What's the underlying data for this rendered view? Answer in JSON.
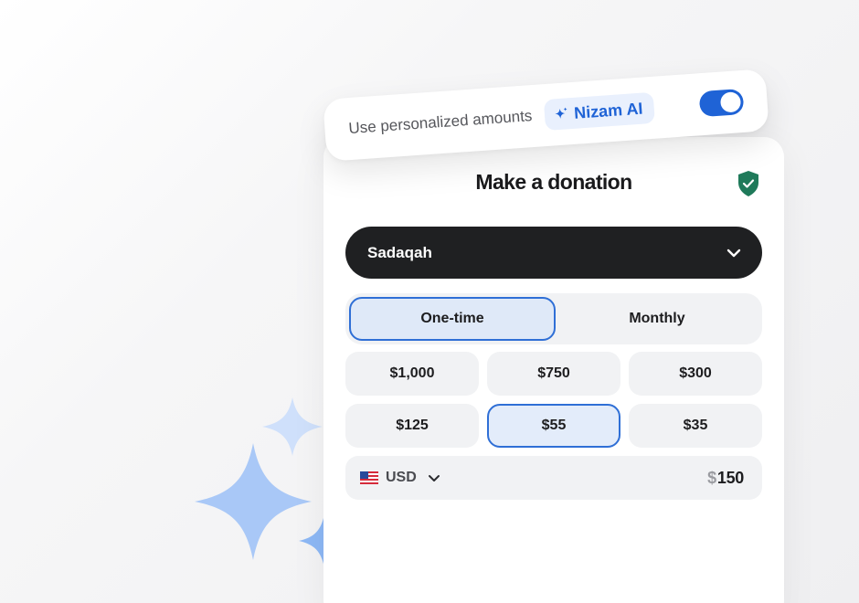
{
  "personalize": {
    "label": "Use personalized amounts",
    "ai_badge": "Nizam AI",
    "ai_icon": "sparkle-icon",
    "toggle_on": true
  },
  "donation": {
    "title": "Make a donation",
    "secure_icon": "shield-check-icon",
    "cause": {
      "selected": "Sadaqah",
      "icon": "chevron-down-icon"
    },
    "frequency": {
      "options": [
        "One-time",
        "Monthly"
      ],
      "selected": "One-time"
    },
    "amounts": [
      "$1,000",
      "$750",
      "$300",
      "$125",
      "$55",
      "$35"
    ],
    "selected_amount": "$55",
    "currency": {
      "code": "USD",
      "flag": "us-flag-icon"
    },
    "amount_symbol": "$",
    "amount_value": "150"
  },
  "colors": {
    "accent": "#1f63d6",
    "selected_bg": "#e3ecfa",
    "dark": "#1f2022",
    "shield": "#1f7a5a"
  }
}
